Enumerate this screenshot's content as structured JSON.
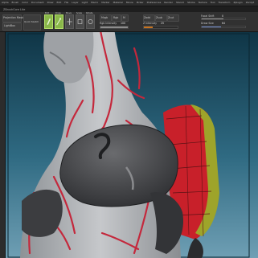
{
  "menubar": {
    "items": [
      "Alpha",
      "Brush",
      "Color",
      "Document",
      "Draw",
      "Edit",
      "File",
      "Layer",
      "Light",
      "Macro",
      "Marker",
      "Material",
      "Movie",
      "Picker",
      "Preferences",
      "Render",
      "Stencil",
      "Stroke",
      "Texture",
      "Tool",
      "Transform",
      "Zplugin",
      "Zscript"
    ]
  },
  "title": "ZBrushCore Lite",
  "toolbar": {
    "projection_master": "Projection Master",
    "lightbox": "LightBox",
    "quick_sketch": "Quick Sketch",
    "edit_label": "Edit",
    "draw_label": "Draw",
    "move_label": "Move",
    "scale_label": "Scale",
    "rotate_label": "Rotate",
    "mrgb_label": "Mrgb",
    "rgb_label": "Rgb",
    "m_label": "M",
    "zadd_label": "Zadd",
    "zsub_label": "Zsub",
    "zcut_label": "Zcut",
    "focal_label": "Focal Shift",
    "focal_value": "0",
    "draw_size_label": "Draw Size",
    "draw_size_value": "64",
    "z_intensity_label": "Z Intensity",
    "z_intensity_value": "25",
    "rgb_intensity_label": "Rgb Intensity",
    "rgb_intensity_value": "100",
    "z_intensity_level": 0.25,
    "draw_size_level": 0.45,
    "rgb_intensity_level": 1.0
  },
  "icons": {
    "edit": "edit-icon",
    "draw": "draw-icon",
    "move": "move-icon",
    "scale": "scale-icon",
    "rotate": "rotate-icon"
  },
  "colors": {
    "active_tool": "#8ab84a",
    "viewport_top": "#12394a",
    "viewport_bottom": "#5c8ea4",
    "skin": "#b4b6ba",
    "vein_red": "#c4283c",
    "armor_dark": "#4a4b4e",
    "pad_red": "#c8202a",
    "pad_yellow": "#9ea42a"
  }
}
